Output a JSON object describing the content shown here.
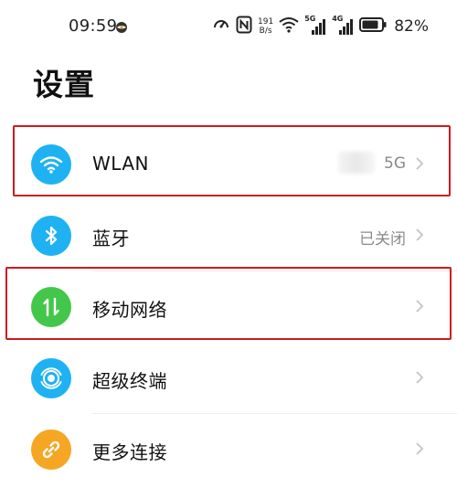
{
  "status_bar": {
    "time": "09:59",
    "net_speed_value": "191",
    "net_speed_unit": "B/s",
    "sim1_tech": "5G",
    "sim2_tech": "4G",
    "battery_percent": "82%",
    "icons": [
      "notification-icon",
      "data-saver-icon",
      "nfc-icon",
      "wifi-icon",
      "signal-sim1-icon",
      "signal-sim2-icon",
      "battery-icon"
    ]
  },
  "page": {
    "title": "设置"
  },
  "rows": [
    {
      "id": "wlan",
      "label": "WLAN",
      "value": "5G",
      "icon": "wifi-icon",
      "icon_color": "#1fb2f2",
      "highlighted": true
    },
    {
      "id": "bluetooth",
      "label": "蓝牙",
      "value": "已关闭",
      "icon": "bluetooth-icon",
      "icon_color": "#1fb2f2",
      "highlighted": false
    },
    {
      "id": "mobile-network",
      "label": "移动网络",
      "value": "",
      "icon": "mobile-data-icon",
      "icon_color": "#43c74a",
      "highlighted": true
    },
    {
      "id": "super-device",
      "label": "超级终端",
      "value": "",
      "icon": "super-device-icon",
      "icon_color": "#1fb2f2",
      "highlighted": false
    },
    {
      "id": "more-connections",
      "label": "更多连接",
      "value": "",
      "icon": "link-icon",
      "icon_color": "#f5a623",
      "highlighted": false
    }
  ],
  "colors": {
    "highlight_border": "#d0181e",
    "secondary_text": "#8a8a8a"
  }
}
